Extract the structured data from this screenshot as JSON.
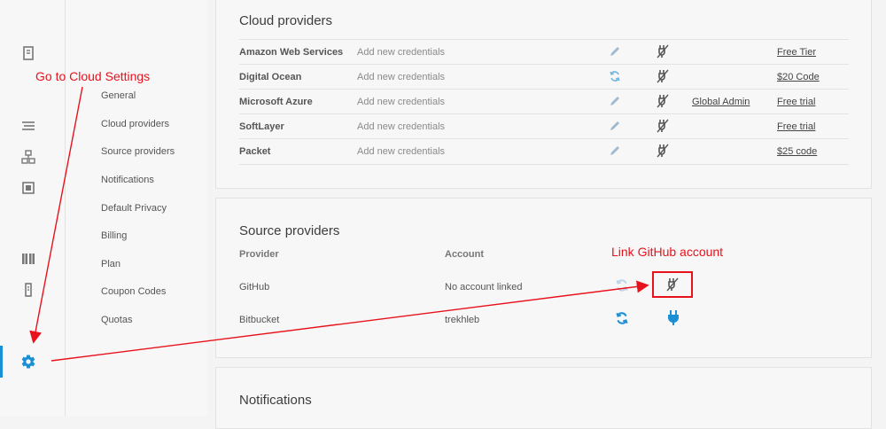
{
  "rail": {
    "icons": [
      "document-icon",
      "list-icon",
      "sitemap-icon",
      "square-icon",
      "book-icon",
      "server-icon",
      "gear-icon"
    ]
  },
  "subnav": {
    "items": [
      {
        "label": "General"
      },
      {
        "label": "Cloud providers"
      },
      {
        "label": "Source providers"
      },
      {
        "label": "Notifications"
      },
      {
        "label": "Default Privacy"
      },
      {
        "label": "Billing"
      },
      {
        "label": "Plan"
      },
      {
        "label": "Coupon Codes"
      },
      {
        "label": "Quotas"
      }
    ]
  },
  "cloud": {
    "title": "Cloud providers",
    "rows": [
      {
        "name": "Amazon Web Services",
        "credentials": "Add new credentials",
        "action_icon": "pencil-icon",
        "extra": "",
        "link": "Free Tier"
      },
      {
        "name": "Digital Ocean",
        "credentials": "Add new credentials",
        "action_icon": "refresh-icon",
        "extra": "",
        "link": "$20 Code"
      },
      {
        "name": "Microsoft Azure",
        "credentials": "Add new credentials",
        "action_icon": "pencil-icon",
        "extra": "Global Admin",
        "link": "Free trial"
      },
      {
        "name": "SoftLayer",
        "credentials": "Add new credentials",
        "action_icon": "pencil-icon",
        "extra": "",
        "link": "Free trial"
      },
      {
        "name": "Packet",
        "credentials": "Add new credentials",
        "action_icon": "pencil-icon",
        "extra": "",
        "link": "$25 code"
      }
    ]
  },
  "source": {
    "title": "Source providers",
    "headers": {
      "provider": "Provider",
      "account": "Account"
    },
    "rows": [
      {
        "provider": "GitHub",
        "account": "No account linked"
      },
      {
        "provider": "Bitbucket",
        "account": "trekhleb"
      }
    ]
  },
  "notifications": {
    "title": "Notifications"
  },
  "annotations": {
    "cloud_settings": "Go to Cloud Settings",
    "link_github": "Link GitHub account"
  },
  "colors": {
    "accent": "#1a8fd6",
    "annotation": "#e8121c",
    "icon_muted": "#9fb9d0",
    "plug_dark": "#555555"
  }
}
